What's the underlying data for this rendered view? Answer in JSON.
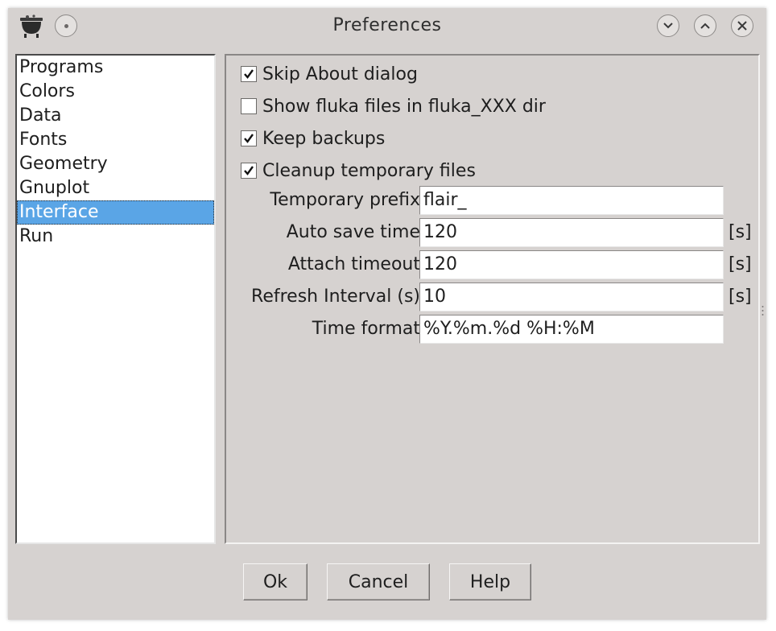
{
  "window": {
    "title": "Preferences",
    "icons": [
      "cauldron-app-icon",
      "pin-icon",
      "minimize-icon",
      "maximize-icon",
      "close-icon"
    ]
  },
  "sidebar": {
    "items": [
      {
        "label": "Programs",
        "selected": false
      },
      {
        "label": "Colors",
        "selected": false
      },
      {
        "label": "Data",
        "selected": false
      },
      {
        "label": "Fonts",
        "selected": false
      },
      {
        "label": "Geometry",
        "selected": false
      },
      {
        "label": "Gnuplot",
        "selected": false
      },
      {
        "label": "Interface",
        "selected": true
      },
      {
        "label": "Run",
        "selected": false
      }
    ]
  },
  "interface": {
    "checkboxes": [
      {
        "label": "Skip About dialog",
        "checked": true
      },
      {
        "label": "Show fluka files in fluka_XXX dir",
        "checked": false
      },
      {
        "label": "Keep backups",
        "checked": true
      },
      {
        "label": "Cleanup temporary files",
        "checked": true
      }
    ],
    "fields": [
      {
        "label": "Temporary prefix",
        "value": "flair_",
        "unit": ""
      },
      {
        "label": "Auto save time",
        "value": "120",
        "unit": "[s]"
      },
      {
        "label": "Attach timeout",
        "value": "120",
        "unit": "[s]"
      },
      {
        "label": "Refresh Interval (s)",
        "value": "10",
        "unit": "[s]"
      },
      {
        "label": "Time format",
        "value": "%Y.%m.%d %H:%M",
        "unit": ""
      }
    ]
  },
  "buttons": {
    "ok": "Ok",
    "cancel": "Cancel",
    "help": "Help"
  },
  "colors": {
    "window_bg": "#d6d2d0",
    "selection": "#5aa5e6"
  }
}
